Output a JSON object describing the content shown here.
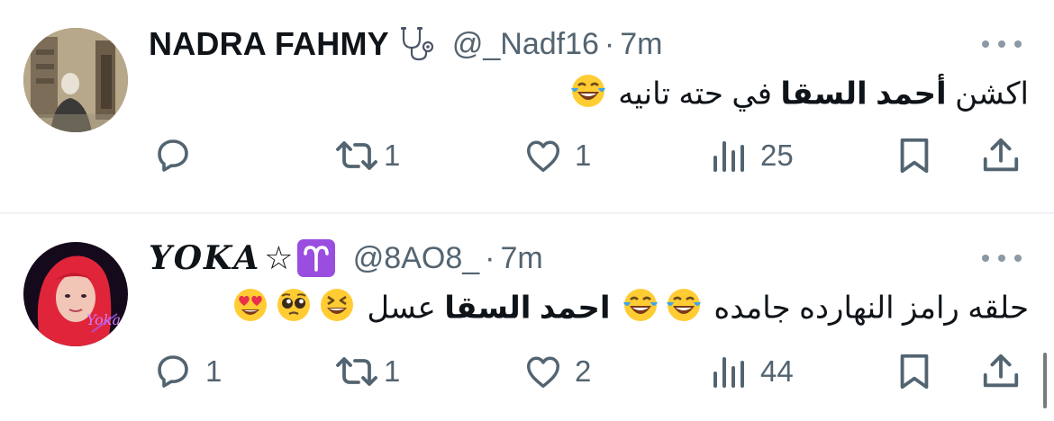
{
  "tweets": [
    {
      "name": "NADRA FAHMY",
      "name_badge_icon": "stethoscope-icon",
      "handle": "@_Nadf16",
      "separator": "·",
      "time": "7m",
      "text_before": "اكشن ",
      "text_bold": "أحمد السقا",
      "text_after": " في حته تانيه ",
      "emojis": [
        "face-with-tears-of-joy"
      ],
      "replies": "",
      "retweets": "1",
      "likes": "1",
      "views": "25"
    },
    {
      "name": "𝒀𝑶𝑲𝑨",
      "name_suffix": "☆",
      "name_badge_icon": "aries-icon",
      "handle": "@8AO8_",
      "separator": "·",
      "time": "7m",
      "text_before": "حلقه رامز النهارده جامده ",
      "text_bold": "احمد السقا",
      "text_after": " عسل ",
      "emojis_after_before": [
        "face-with-tears-of-joy",
        "face-with-tears-of-joy"
      ],
      "emojis": [
        "grinning-squinting-face",
        "pleading-face",
        "heart-eyes-face"
      ],
      "replies": "1",
      "retweets": "1",
      "likes": "2",
      "views": "44"
    }
  ],
  "colors": {
    "text": "#0f1419",
    "muted": "#536471",
    "divider": "#eff3f4",
    "aries_bg": "#9a4ee0",
    "emoji_yellow": "#ffcc33"
  }
}
